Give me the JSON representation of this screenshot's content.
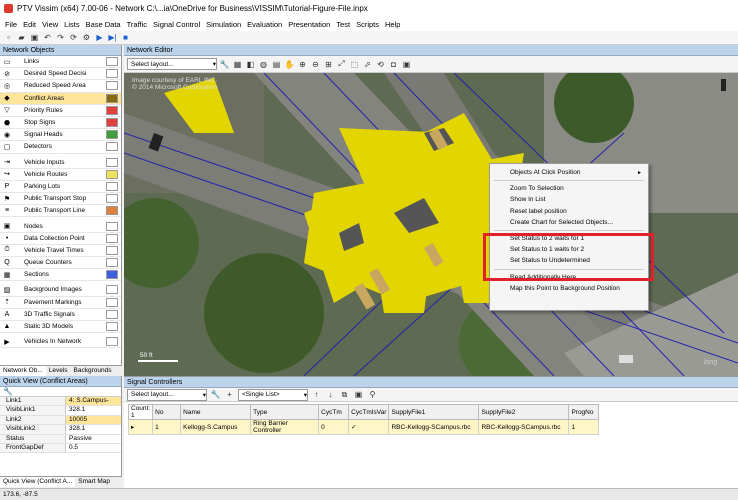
{
  "window": {
    "title": "PTV Vissim (x64) 7.00-06 - Network C:\\...ia\\OneDrive for Business\\VISSIM\\Tutorial-Figure-File.inpx"
  },
  "menu": [
    "File",
    "Edit",
    "View",
    "Lists",
    "Base Data",
    "Traffic",
    "Signal Control",
    "Simulation",
    "Evaluation",
    "Presentation",
    "Test",
    "Scripts",
    "Help"
  ],
  "network_objects": {
    "header": "Network Objects",
    "items": [
      {
        "label": "Links",
        "icon": "link-icon",
        "swatch": "#ffffff"
      },
      {
        "label": "Desired Speed Decisi",
        "icon": "speed-decision-icon",
        "swatch": "#ffffff"
      },
      {
        "label": "Reduced Speed Area",
        "icon": "reduced-speed-icon",
        "swatch": "#ffffff"
      },
      {
        "label": "Conflict Areas",
        "icon": "conflict-area-icon",
        "swatch": "#8a6a10",
        "selected": true
      },
      {
        "label": "Priority Rules",
        "icon": "priority-rule-icon",
        "swatch": "#e04040"
      },
      {
        "label": "Stop Signs",
        "icon": "stop-sign-icon",
        "swatch": "#e04040"
      },
      {
        "label": "Signal Heads",
        "icon": "signal-head-icon",
        "swatch": "#40a040"
      },
      {
        "label": "Detectors",
        "icon": "detector-icon",
        "swatch": "#ffffff"
      },
      {
        "label": "Vehicle Inputs",
        "icon": "vehicle-input-icon",
        "swatch": "#ffffff"
      },
      {
        "label": "Vehicle Routes",
        "icon": "vehicle-route-icon",
        "swatch": "#f0e060"
      },
      {
        "label": "Parking Lots",
        "icon": "parking-lot-icon",
        "swatch": "#ffffff"
      },
      {
        "label": "Public Transport Stop",
        "icon": "pt-stop-icon",
        "swatch": "#ffffff"
      },
      {
        "label": "Public Transport Line",
        "icon": "pt-line-icon",
        "swatch": "#e08040"
      },
      {
        "label": "Nodes",
        "icon": "node-icon",
        "swatch": "#ffffff"
      },
      {
        "label": "Data Collection Point",
        "icon": "data-point-icon",
        "swatch": "#ffffff"
      },
      {
        "label": "Vehicle Travel Times",
        "icon": "travel-time-icon",
        "swatch": "#ffffff"
      },
      {
        "label": "Queue Counters",
        "icon": "queue-counter-icon",
        "swatch": "#ffffff"
      },
      {
        "label": "Sections",
        "icon": "section-icon",
        "swatch": "#4060e0"
      },
      {
        "label": "Background Images",
        "icon": "background-image-icon",
        "swatch": "#ffffff"
      },
      {
        "label": "Pavement Markings",
        "icon": "pavement-marking-icon",
        "swatch": "#ffffff"
      },
      {
        "label": "3D Traffic Signals",
        "icon": "traffic-signal-3d-icon",
        "swatch": "#ffffff"
      },
      {
        "label": "Static 3D Models",
        "icon": "static-model-icon",
        "swatch": "#ffffff"
      },
      {
        "label": "Vehicles In Network",
        "icon": "vehicle-network-icon",
        "swatch": "#ffffff"
      }
    ],
    "tabs": [
      "Network Ob...",
      "Levels",
      "Backgrounds"
    ]
  },
  "quick_view": {
    "header": "Quick View (Conflict Areas)",
    "rows": [
      {
        "k": "Link1",
        "v": "4: S.Campus-"
      },
      {
        "k": "VisibLink1",
        "v": "328.1"
      },
      {
        "k": "Link2",
        "v": "10005"
      },
      {
        "k": "VisibLink2",
        "v": "328.1"
      },
      {
        "k": "Status",
        "v": "Passive"
      },
      {
        "k": "FrontGapDef",
        "v": "0.5"
      }
    ],
    "tabs": [
      "Quick View (Conflict A...",
      "Smart Map"
    ]
  },
  "editor": {
    "header": "Network Editor",
    "layout_placeholder": "Select layout...",
    "watermark1": "Image courtesy of EARL INC.",
    "watermark2": "© 2014 Microsoft Corporation",
    "scale": "50 ft",
    "logo": "bing"
  },
  "context_menu": {
    "items": [
      {
        "label": "Objects At Click Position",
        "arrow": "►"
      },
      {
        "sep": true
      },
      {
        "label": "Zoom To Selection"
      },
      {
        "label": "Show In List"
      },
      {
        "label": "Reset label position"
      },
      {
        "label": "Create Chart for Selected Objects..."
      },
      {
        "sep": true
      },
      {
        "label": "Set Status to 2 waits for 1"
      },
      {
        "label": "Set Status to 1 waits for 2"
      },
      {
        "label": "Set Status to Undetermined"
      },
      {
        "sep": true
      },
      {
        "label": "Read Additionally Here"
      },
      {
        "label": "Map this Point to Background Position"
      }
    ]
  },
  "signal_controllers": {
    "header": "Signal Controllers",
    "layout_placeholder": "Select layout...",
    "list_placeholder": "<Single List>",
    "count_label": "Count: 1",
    "columns": [
      "No",
      "Name",
      "Type",
      "CycTm",
      "CycTmIsVar",
      "SupplyFile1",
      "SupplyFile2",
      "ProgNo"
    ],
    "rows": [
      {
        "No": "1",
        "Name": "Kellogg-S.Campus",
        "Type": "Ring Barrier Controller",
        "CycTm": "0",
        "CycTmIsVar": "✓",
        "SupplyFile1": "RBC-Kellogg-SCampus.rbc",
        "SupplyFile2": "RBC-Kellogg-SCampus.rbc",
        "ProgNo": "1"
      }
    ]
  },
  "status": {
    "coords": "173.6, -87.5"
  },
  "colors": {
    "accent": "#bcd3ec",
    "highlight": "#e0202a",
    "conflict": "#e6d800"
  }
}
